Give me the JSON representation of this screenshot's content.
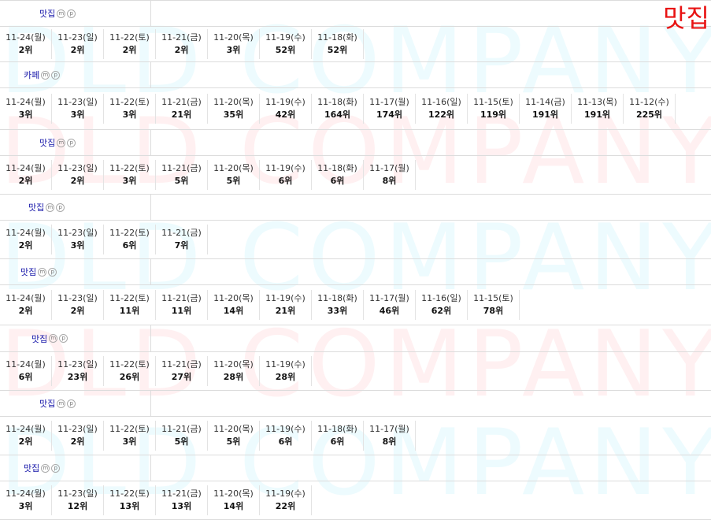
{
  "corner_label": "맛집",
  "watermark_text": "DLD COMPANY",
  "badges": {
    "m": "m",
    "p": "p"
  },
  "blocks": [
    {
      "name": "맛집",
      "name_indent": 50,
      "name_height": 32,
      "rank_height": 44,
      "ranks": [
        {
          "date": "11-24(월)",
          "rank": "2위"
        },
        {
          "date": "11-23(일)",
          "rank": "2위"
        },
        {
          "date": "11-22(토)",
          "rank": "2위"
        },
        {
          "date": "11-21(금)",
          "rank": "2위"
        },
        {
          "date": "11-20(목)",
          "rank": "3위"
        },
        {
          "date": "11-19(수)",
          "rank": "52위"
        },
        {
          "date": "11-18(화)",
          "rank": "52위"
        }
      ]
    },
    {
      "name": "카페",
      "name_indent": 30,
      "name_height": 32,
      "rank_height": 52,
      "ranks": [
        {
          "date": "11-24(월)",
          "rank": "3위"
        },
        {
          "date": "11-23(일)",
          "rank": "3위"
        },
        {
          "date": "11-22(토)",
          "rank": "3위"
        },
        {
          "date": "11-21(금)",
          "rank": "21위"
        },
        {
          "date": "11-20(목)",
          "rank": "35위"
        },
        {
          "date": "11-19(수)",
          "rank": "42위"
        },
        {
          "date": "11-18(화)",
          "rank": "164위"
        },
        {
          "date": "11-17(월)",
          "rank": "174위"
        },
        {
          "date": "11-16(일)",
          "rank": "122위"
        },
        {
          "date": "11-15(토)",
          "rank": "119위"
        },
        {
          "date": "11-14(금)",
          "rank": "191위"
        },
        {
          "date": "11-13(목)",
          "rank": "191위"
        },
        {
          "date": "11-12(수)",
          "rank": "225위"
        }
      ]
    },
    {
      "name": "맛집",
      "name_indent": 50,
      "name_height": 32,
      "rank_height": 48,
      "ranks": [
        {
          "date": "11-24(월)",
          "rank": "2위"
        },
        {
          "date": "11-23(일)",
          "rank": "2위"
        },
        {
          "date": "11-22(토)",
          "rank": "3위"
        },
        {
          "date": "11-21(금)",
          "rank": "5위"
        },
        {
          "date": "11-20(목)",
          "rank": "5위"
        },
        {
          "date": "11-19(수)",
          "rank": "6위"
        },
        {
          "date": "11-18(화)",
          "rank": "6위"
        },
        {
          "date": "11-17(월)",
          "rank": "8위"
        }
      ]
    },
    {
      "name": "맛집",
      "name_indent": 36,
      "name_height": 32,
      "rank_height": 48,
      "ranks": [
        {
          "date": "11-24(월)",
          "rank": "2위"
        },
        {
          "date": "11-23(일)",
          "rank": "3위"
        },
        {
          "date": "11-22(토)",
          "rank": "6위"
        },
        {
          "date": "11-21(금)",
          "rank": "7위"
        }
      ]
    },
    {
      "name": "맛집",
      "name_indent": 26,
      "name_height": 32,
      "rank_height": 50,
      "ranks": [
        {
          "date": "11-24(월)",
          "rank": "2위"
        },
        {
          "date": "11-23(일)",
          "rank": "2위"
        },
        {
          "date": "11-22(토)",
          "rank": "11위"
        },
        {
          "date": "11-21(금)",
          "rank": "11위"
        },
        {
          "date": "11-20(목)",
          "rank": "14위"
        },
        {
          "date": "11-19(수)",
          "rank": "21위"
        },
        {
          "date": "11-18(화)",
          "rank": "33위"
        },
        {
          "date": "11-17(월)",
          "rank": "46위"
        },
        {
          "date": "11-16(일)",
          "rank": "62위"
        },
        {
          "date": "11-15(토)",
          "rank": "78위"
        }
      ]
    },
    {
      "name": "맛집",
      "name_indent": 40,
      "name_height": 33,
      "rank_height": 48,
      "ranks": [
        {
          "date": "11-24(월)",
          "rank": "6위"
        },
        {
          "date": "11-23(일)",
          "rank": "23위"
        },
        {
          "date": "11-22(토)",
          "rank": "26위"
        },
        {
          "date": "11-21(금)",
          "rank": "27위"
        },
        {
          "date": "11-20(목)",
          "rank": "28위"
        },
        {
          "date": "11-19(수)",
          "rank": "28위"
        }
      ]
    },
    {
      "name": "맛집",
      "name_indent": 50,
      "name_height": 32,
      "rank_height": 48,
      "ranks": [
        {
          "date": "11-24(월)",
          "rank": "2위"
        },
        {
          "date": "11-23(일)",
          "rank": "2위"
        },
        {
          "date": "11-22(토)",
          "rank": "3위"
        },
        {
          "date": "11-21(금)",
          "rank": "5위"
        },
        {
          "date": "11-20(목)",
          "rank": "5위"
        },
        {
          "date": "11-19(수)",
          "rank": "6위"
        },
        {
          "date": "11-18(화)",
          "rank": "6위"
        },
        {
          "date": "11-17(월)",
          "rank": "8위"
        }
      ]
    },
    {
      "name": "맛집",
      "name_indent": 30,
      "name_height": 32,
      "rank_height": 48,
      "ranks": [
        {
          "date": "11-24(월)",
          "rank": "3위"
        },
        {
          "date": "11-23(일)",
          "rank": "12위"
        },
        {
          "date": "11-22(토)",
          "rank": "13위"
        },
        {
          "date": "11-21(금)",
          "rank": "13위"
        },
        {
          "date": "11-20(목)",
          "rank": "14위"
        },
        {
          "date": "11-19(수)",
          "rank": "22위"
        }
      ]
    }
  ]
}
